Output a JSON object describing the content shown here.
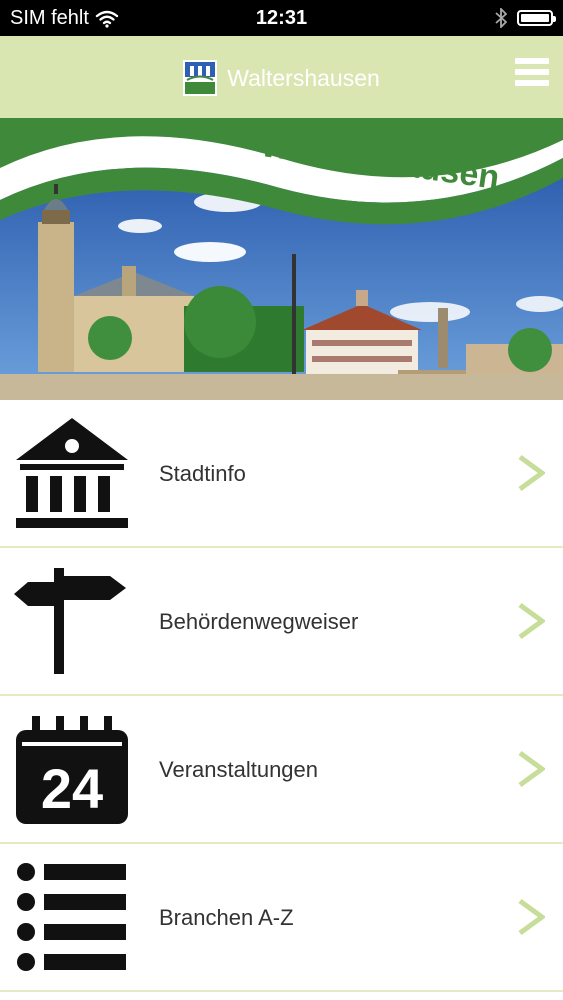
{
  "status_bar": {
    "carrier": "SIM fehlt",
    "time": "12:31"
  },
  "header": {
    "title": "Waltershausen"
  },
  "hero": {
    "banner_text": "Waltershausen"
  },
  "menu": [
    {
      "label": "Stadtinfo",
      "icon": "town-hall-icon"
    },
    {
      "label": "Behördenwegweiser",
      "icon": "signpost-icon"
    },
    {
      "label": "Veranstaltungen",
      "icon": "calendar-icon",
      "icon_text": "24"
    },
    {
      "label": "Branchen A-Z",
      "icon": "list-icon"
    }
  ],
  "colors": {
    "accent": "#d9e6b1",
    "chevron": "#c7dd9a",
    "banner_green": "#3f8a3a",
    "sky": "#2f63b5"
  }
}
